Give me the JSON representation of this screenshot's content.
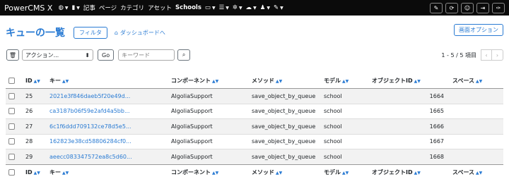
{
  "app": {
    "brand": "PowerCMS X"
  },
  "nav": {
    "items": [
      "記事",
      "ページ",
      "カテゴリ",
      "アセット"
    ],
    "workspace": "Schools"
  },
  "header": {
    "title": "キューの一覧",
    "filter_label": "フィルタ",
    "dashboard_label": "ダッシュボードへ",
    "view_options_label": "画面オプション"
  },
  "actions": {
    "select_label": "アクション...",
    "go_label": "Go",
    "keyword_placeholder": "キーワード"
  },
  "pager": {
    "count_text": "1 - 5 / 5 項目"
  },
  "table": {
    "columns": [
      "ID",
      "キー",
      "コンポーネント",
      "メソッド",
      "モデル",
      "オブジェクトID",
      "スペース"
    ],
    "rows": [
      {
        "id": "25",
        "key": "2021e3f846daeb5f20e49d...",
        "component": "AlgoliaSupport",
        "method": "save_object_by_queue",
        "model": "school",
        "object_id": "1664",
        "space": ""
      },
      {
        "id": "26",
        "key": "ca3187b06f59e2afd4a5bb...",
        "component": "AlgoliaSupport",
        "method": "save_object_by_queue",
        "model": "school",
        "object_id": "1665",
        "space": ""
      },
      {
        "id": "27",
        "key": "6c1f6ddd709132ce78d5e5...",
        "component": "AlgoliaSupport",
        "method": "save_object_by_queue",
        "model": "school",
        "object_id": "1666",
        "space": ""
      },
      {
        "id": "28",
        "key": "162823e38cd58806284cf0...",
        "component": "AlgoliaSupport",
        "method": "save_object_by_queue",
        "model": "school",
        "object_id": "1667",
        "space": ""
      },
      {
        "id": "29",
        "key": "aeecc083347572ea8c5d60...",
        "component": "AlgoliaSupport",
        "method": "save_object_by_queue",
        "model": "school",
        "object_id": "1668",
        "space": ""
      }
    ]
  }
}
